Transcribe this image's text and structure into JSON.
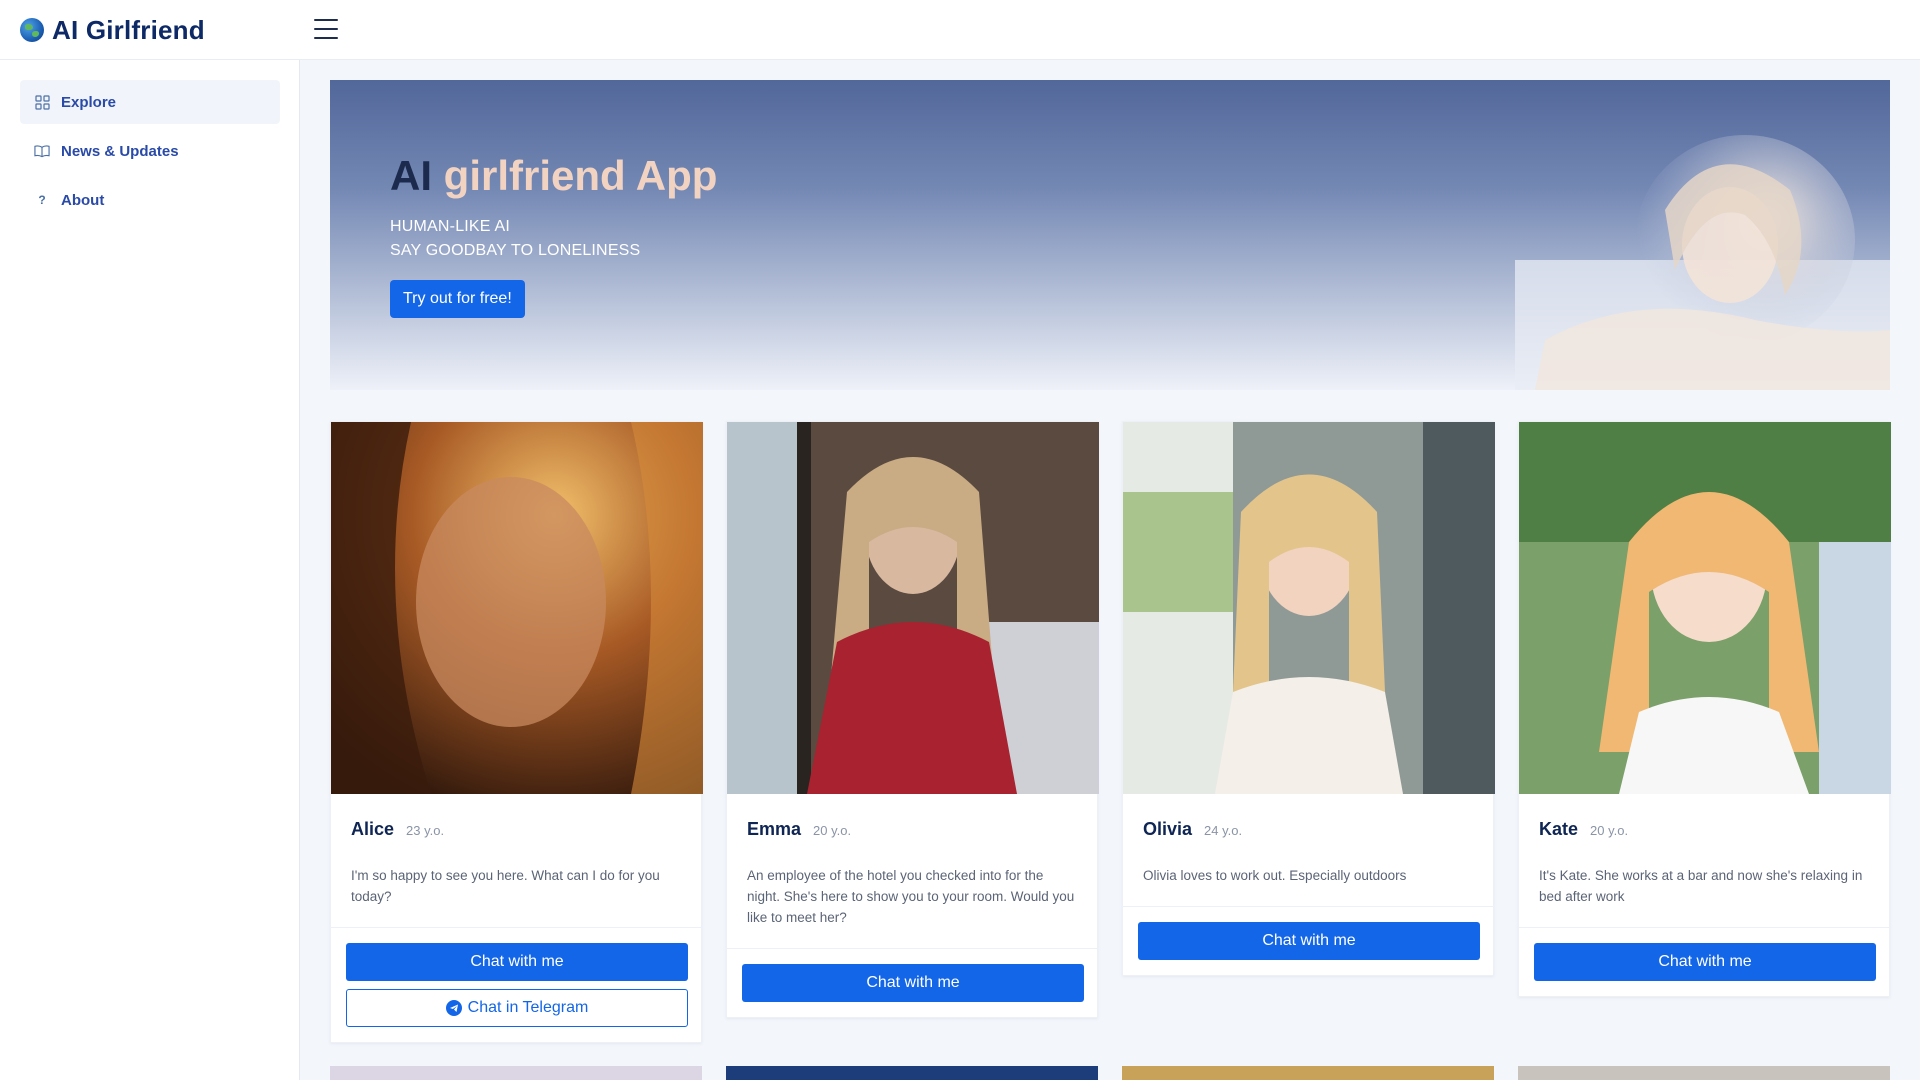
{
  "app": {
    "title": "AI Girlfriend",
    "logo_icon": "globe-icon"
  },
  "header": {
    "menu_icon": "hamburger-icon"
  },
  "sidebar": {
    "items": [
      {
        "label": "Explore",
        "icon": "grid-icon",
        "active": true
      },
      {
        "label": "News & Updates",
        "icon": "book-icon",
        "active": false
      },
      {
        "label": "About",
        "icon": "question-icon",
        "active": false
      }
    ]
  },
  "hero": {
    "title_part1": "AI",
    "title_part2": "girlfriend App",
    "subtitle_1": "HUMAN-LIKE AI",
    "subtitle_2": "SAY GOODBAY TO LONELINESS",
    "cta_label": "Try out for free!",
    "accent": "#1366e8"
  },
  "cards": [
    {
      "name": "Alice",
      "age": "23 y.o.",
      "description": "I'm so happy to see you here. What can I do for you today?",
      "chat_label": "Chat with me",
      "telegram_label": "Chat in Telegram"
    },
    {
      "name": "Emma",
      "age": "20 y.o.",
      "description": "An employee of the hotel you checked into for the night. She's here to show you to your room. Would you like to meet her?",
      "chat_label": "Chat with me"
    },
    {
      "name": "Olivia",
      "age": "24 y.o.",
      "description": "Olivia loves to work out. Especially outdoors",
      "chat_label": "Chat with me"
    },
    {
      "name": "Kate",
      "age": "20 y.o.",
      "description": "It's Kate. She works at a bar and now she's relaxing in bed after work",
      "chat_label": "Chat with me"
    }
  ],
  "colors": {
    "primary": "#1366e8",
    "brand_text": "#0d2a66",
    "sidebar_link": "#2a4aa8"
  }
}
